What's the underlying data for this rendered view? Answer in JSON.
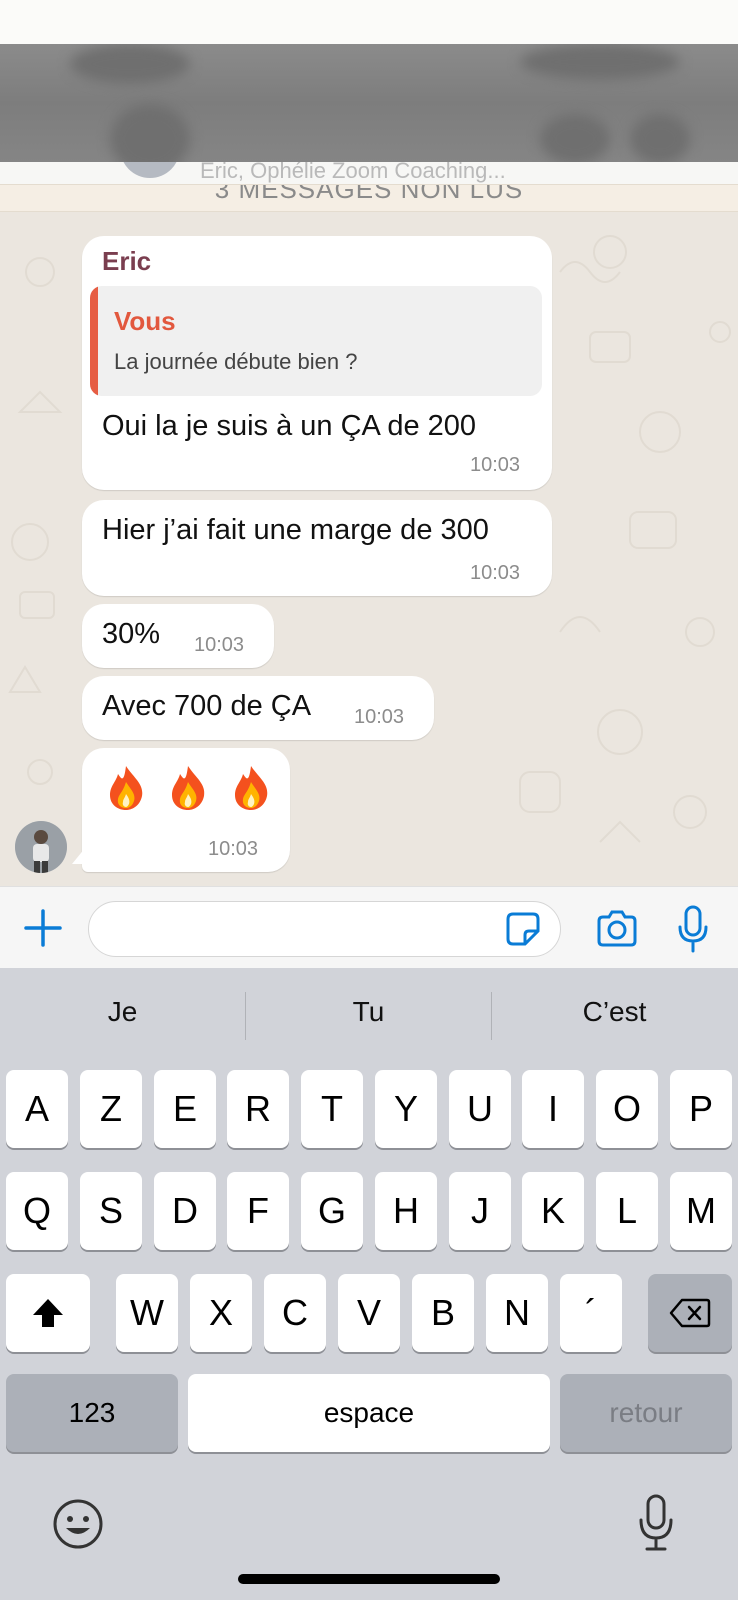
{
  "header": {
    "subtitle_peek": "Eric, Ophélie Zoom Coaching...",
    "unread_banner": "3 MESSAGES NON LUS"
  },
  "messages": [
    {
      "sender": "Eric",
      "quote_name": "Vous",
      "quote_text": "La journée débute bien ?",
      "text": "Oui la je suis à un ÇA de 200",
      "time": "10:03"
    },
    {
      "text": "Hier j’ai fait une marge de 300",
      "time": "10:03"
    },
    {
      "text": "30%",
      "time": "10:03"
    },
    {
      "text": "Avec 700 de ÇA",
      "time": "10:03"
    },
    {
      "text": "🔥🔥🔥",
      "time": "10:03"
    }
  ],
  "input": {
    "placeholder": ""
  },
  "keyboard": {
    "suggestions": [
      "Je",
      "Tu",
      "C’est"
    ],
    "row1": [
      "A",
      "Z",
      "E",
      "R",
      "T",
      "Y",
      "U",
      "I",
      "O",
      "P"
    ],
    "row2": [
      "Q",
      "S",
      "D",
      "F",
      "G",
      "H",
      "J",
      "K",
      "L",
      "M"
    ],
    "row3": [
      "W",
      "X",
      "C",
      "V",
      "B",
      "N",
      "´"
    ],
    "numbers_label": "123",
    "space_label": "espace",
    "return_label": "retour"
  },
  "colors": {
    "chat_bg": "#ebe6df",
    "bubble": "#ffffff",
    "sender_name": "#7a3e4f",
    "quote_accent": "#e65d43",
    "icon_blue": "#0a7cd6",
    "keyboard_bg": "#d1d3d9"
  }
}
